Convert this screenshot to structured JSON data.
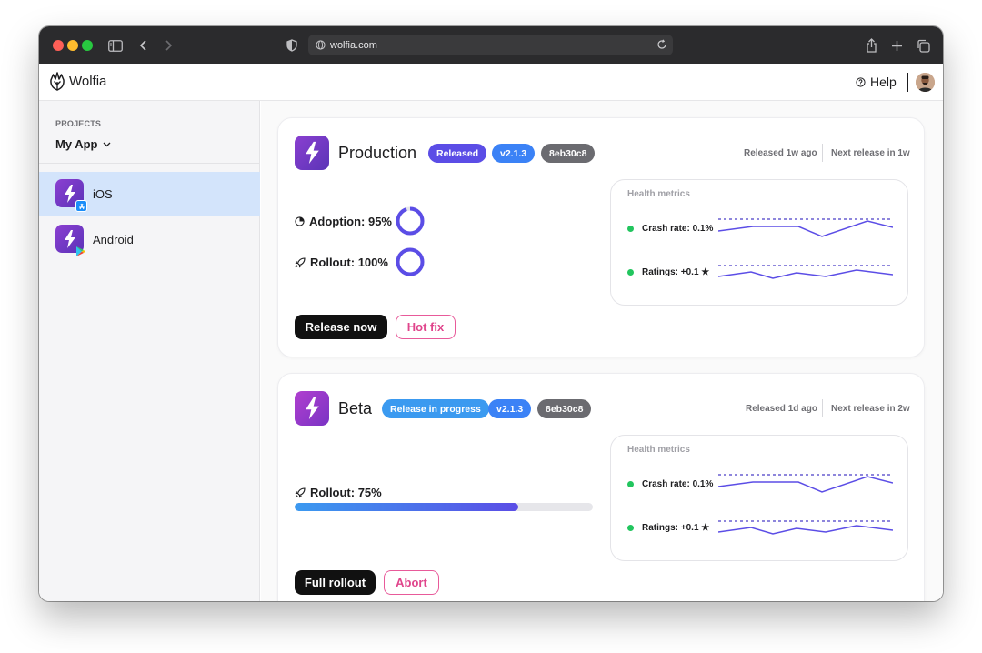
{
  "browser": {
    "url": "wolfia.com"
  },
  "header": {
    "brand": "Wolfia",
    "help_label": "Help"
  },
  "sidebar": {
    "section_label": "PROJECTS",
    "project_name": "My App",
    "items": [
      {
        "label": "iOS",
        "selected": true
      },
      {
        "label": "Android",
        "selected": false
      }
    ]
  },
  "cards": [
    {
      "title": "Production",
      "status": "Released",
      "version": "v2.1.3",
      "commit": "8eb30c8",
      "released": "Released 1w ago",
      "next_release": "Next release in 1w",
      "adoption_label": "Adoption: 95%",
      "adoption_value": 0.95,
      "rollout_label": "Rollout: 100%",
      "rollout_value": 1.0,
      "health_title": "Health metrics",
      "crash_label": "Crash rate: 0.1%",
      "ratings_label": "Ratings: +0.1 ★",
      "primary_button": "Release now",
      "secondary_button": "Hot fix"
    },
    {
      "title": "Beta",
      "status": "Release in progress",
      "version": "v2.1.3",
      "commit": "8eb30c8",
      "released": "Released 1d ago",
      "next_release": "Next release in 2w",
      "rollout_label": "Rollout: 75%",
      "rollout_value": 0.75,
      "health_title": "Health metrics",
      "crash_label": "Crash rate: 0.1%",
      "ratings_label": "Ratings: +0.1 ★",
      "primary_button": "Full rollout",
      "secondary_button": "Abort"
    }
  ],
  "colors": {
    "accent": "#5b4de6",
    "blue": "#3b82f6",
    "pill_gray": "#6b6b70",
    "green": "#22c55e",
    "pink": "#e0458c",
    "selected_bg": "#d3e4fb"
  }
}
